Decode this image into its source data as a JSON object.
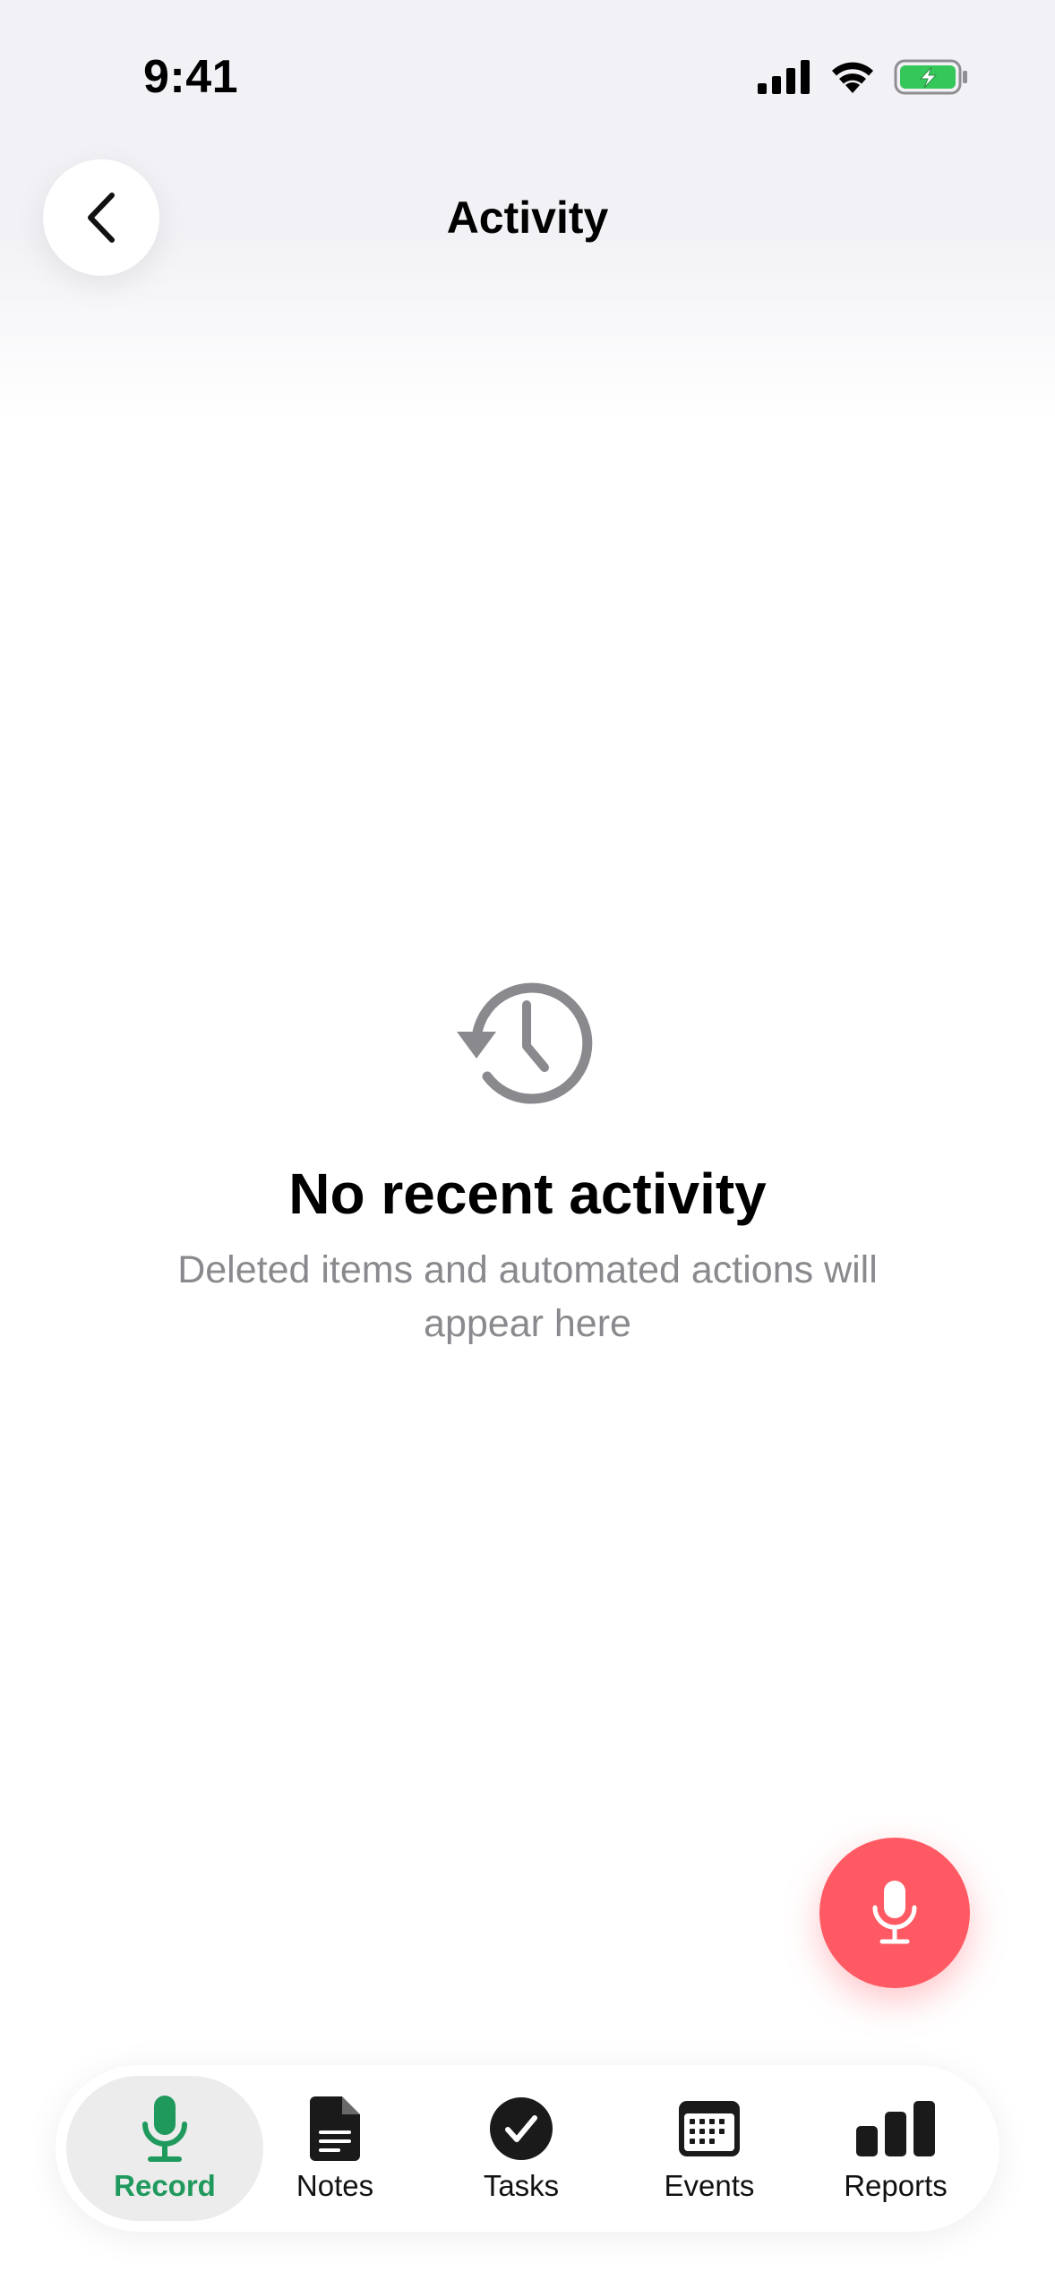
{
  "status_bar": {
    "time": "9:41"
  },
  "header": {
    "title": "Activity"
  },
  "empty_state": {
    "title": "No recent activity",
    "subtitle": "Deleted items and automated actions will appear here"
  },
  "tab_bar": {
    "tabs": [
      {
        "label": "Record",
        "icon": "mic-icon",
        "active": true
      },
      {
        "label": "Notes",
        "icon": "document-icon",
        "active": false
      },
      {
        "label": "Tasks",
        "icon": "check-circle-icon",
        "active": false
      },
      {
        "label": "Events",
        "icon": "calendar-icon",
        "active": false
      },
      {
        "label": "Reports",
        "icon": "bar-chart-icon",
        "active": false
      }
    ]
  },
  "colors": {
    "accent_green": "#1f9a5c",
    "record_red": "#ff5a64",
    "battery_green": "#35c759",
    "secondary_gray": "#8a8a8e"
  }
}
